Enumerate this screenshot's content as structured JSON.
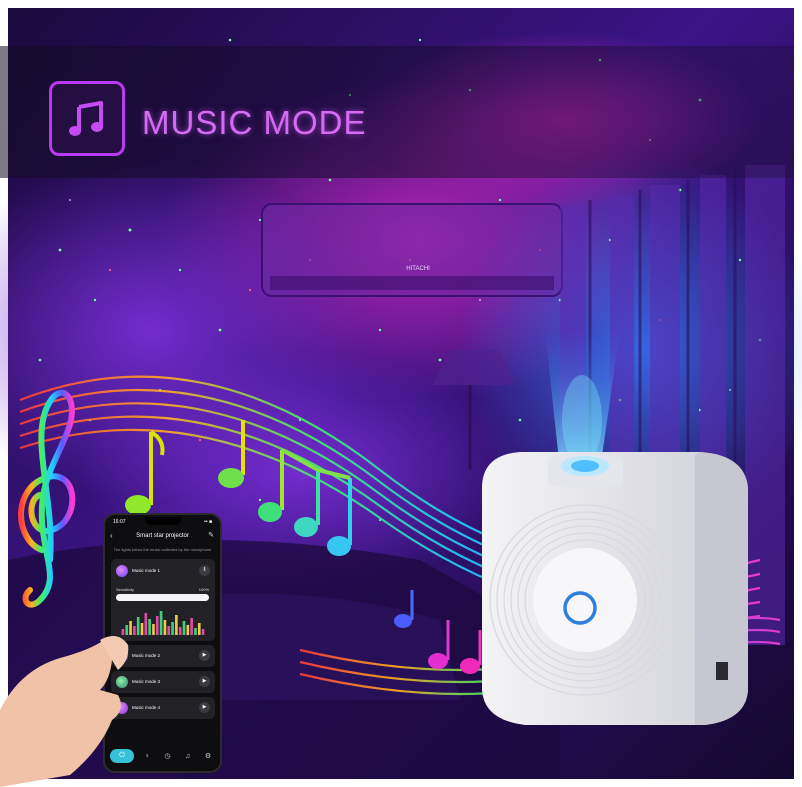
{
  "banner": {
    "title": "MUSIC MODE",
    "icon": "music-note-icon",
    "accent_color": "#c040f0"
  },
  "phone_app": {
    "status_time": "16:07",
    "status_right": "•• ■",
    "title": "Smart star projector",
    "subtitle": "The lights follow the music collected by the microphone",
    "modes": [
      {
        "label": "Music mode 1",
        "state": "playing",
        "color": "#9b5cf5"
      },
      {
        "label": "Music mode 2",
        "state": "stopped",
        "color": "#6b63f0"
      },
      {
        "label": "Music mode 3",
        "state": "stopped",
        "color": "#3fb88a"
      },
      {
        "label": "Music mode 4",
        "state": "stopped",
        "color": "#b44ff0"
      }
    ],
    "sensitivity_label": "Sensitivity",
    "sensitivity_value": "100%",
    "sensitivity_fraction": 1.0,
    "pause_glyph": "‖",
    "play_glyph": "▶",
    "tabs": [
      {
        "icon": "power-icon",
        "active": true
      },
      {
        "icon": "bulb-icon",
        "active": false
      },
      {
        "icon": "timer-icon",
        "active": false
      },
      {
        "icon": "music-icon",
        "active": false
      },
      {
        "icon": "settings-icon",
        "active": false
      }
    ]
  },
  "scene": {
    "ac_brand": "HITACHI",
    "sky_colors": [
      "#2a0b63",
      "#6b1fb0",
      "#b01f9a",
      "#123c8f"
    ]
  }
}
